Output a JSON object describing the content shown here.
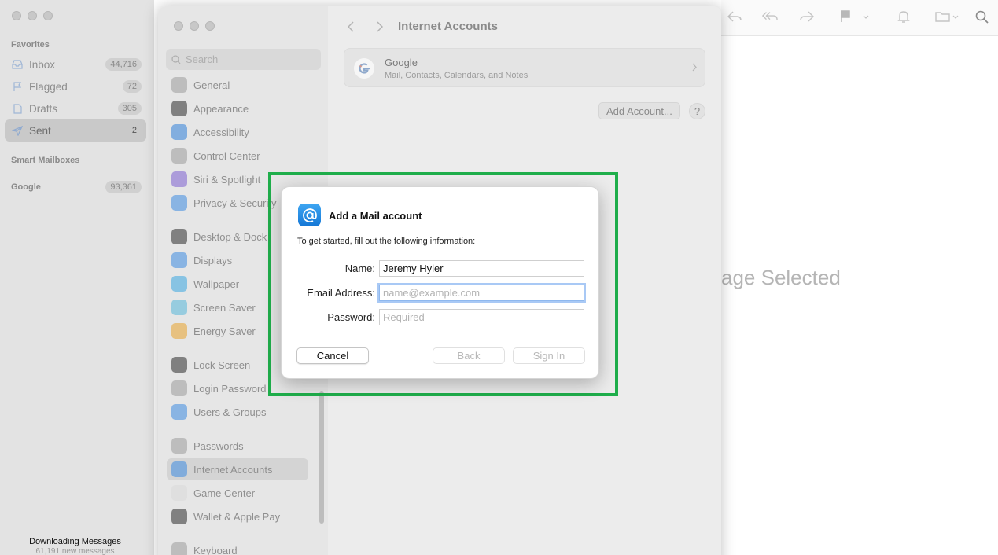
{
  "mail": {
    "favorites_title": "Favorites",
    "mailboxes": [
      {
        "label": "Inbox",
        "count": "44,716"
      },
      {
        "label": "Flagged",
        "count": "72"
      },
      {
        "label": "Drafts",
        "count": "305"
      },
      {
        "label": "Sent",
        "count": "2"
      }
    ],
    "smart_mailboxes_title": "Smart Mailboxes",
    "google": {
      "label": "Google",
      "count": "93,361"
    },
    "status_title": "Downloading Messages",
    "status_sub": "61,191 new messages",
    "no_message_text": "age Selected"
  },
  "settings": {
    "search_placeholder": "Search",
    "nav_items": [
      {
        "label": "General",
        "color": "#9a9a9a"
      },
      {
        "label": "Appearance",
        "color": "#2b2b2b"
      },
      {
        "label": "Accessibility",
        "color": "#2f7fd8"
      },
      {
        "label": "Control Center",
        "color": "#9a9a9a"
      },
      {
        "label": "Siri & Spotlight",
        "color": "#7b5fd0"
      },
      {
        "label": "Privacy & Security",
        "color": "#3d8ae0"
      },
      {
        "label": "Desktop & Dock",
        "color": "#2b2b2b"
      },
      {
        "label": "Displays",
        "color": "#3d8ae0"
      },
      {
        "label": "Wallpaper",
        "color": "#38a6e0"
      },
      {
        "label": "Screen Saver",
        "color": "#56b6d8"
      },
      {
        "label": "Energy Saver",
        "color": "#e8a22b"
      },
      {
        "label": "Lock Screen",
        "color": "#2b2b2b"
      },
      {
        "label": "Login Password",
        "color": "#9a9a9a"
      },
      {
        "label": "Users & Groups",
        "color": "#3d8ae0"
      },
      {
        "label": "Passwords",
        "color": "#9a9a9a"
      },
      {
        "label": "Internet Accounts",
        "color": "#3d8ae0"
      },
      {
        "label": "Game Center",
        "color": "#d8d8d8"
      },
      {
        "label": "Wallet & Apple Pay",
        "color": "#2b2b2b"
      },
      {
        "label": "Keyboard",
        "color": "#9a9a9a"
      }
    ],
    "pane_title": "Internet Accounts",
    "account": {
      "name": "Google",
      "description": "Mail, Contacts, Calendars, and Notes"
    },
    "add_account_label": "Add Account...",
    "help_label": "?"
  },
  "dialog": {
    "title": "Add a Mail account",
    "subtitle": "To get started, fill out the following information:",
    "name_label": "Name:",
    "name_value": "Jeremy Hyler",
    "email_label": "Email Address:",
    "email_placeholder": "name@example.com",
    "password_label": "Password:",
    "password_placeholder": "Required",
    "cancel_label": "Cancel",
    "back_label": "Back",
    "signin_label": "Sign In"
  },
  "colors": {
    "highlight": "#1fae4b",
    "accent": "#1577d6"
  }
}
